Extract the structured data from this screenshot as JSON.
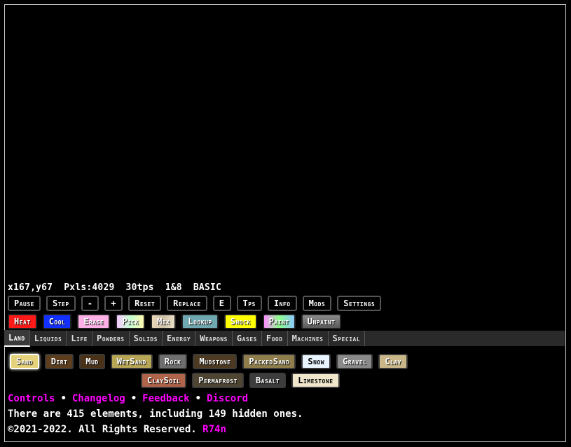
{
  "stats": "x167,y67  Pxls:4029  30tps  1&8  BASIC",
  "controls": [
    "Pause",
    "Step",
    "-",
    "+",
    "Reset",
    "Replace",
    "E",
    "Tps",
    "Info",
    "Mods",
    "Settings"
  ],
  "tools": [
    {
      "label": "Heat",
      "bg": "#ff1a1a",
      "color": "#ffffff"
    },
    {
      "label": "Cool",
      "bg": "#1230ff",
      "color": "#ffffff"
    },
    {
      "label": "Erase",
      "bg": "#ffb0e6",
      "color": "#ffffff"
    },
    {
      "label": "Pick",
      "bg": "linear-gradient(90deg,#f6c9ff,#c4ffd0,#fffab0)",
      "color": "#ffffff"
    },
    {
      "label": "Mix",
      "bg": "linear-gradient(90deg,#e9d7b8,#cdbfa8,#e9dfc6)",
      "color": "#ffffff"
    },
    {
      "label": "Lookup",
      "bg": "#6fa8b0",
      "color": "#ffffff"
    },
    {
      "label": "Shock",
      "bg": "#ffff00",
      "color": "#ffffff"
    },
    {
      "label": "Paint",
      "bg": "linear-gradient(90deg,#ff8cff,#8cff8c,#8cc8ff)",
      "color": "#ffffff"
    },
    {
      "label": "Unpaint",
      "bg": "linear-gradient(180deg,#8c8c8c,#5a5a5a)",
      "color": "#ffffff"
    }
  ],
  "categories": [
    "Land",
    "Liquids",
    "Life",
    "Powders",
    "Solids",
    "Energy",
    "Weapons",
    "Gases",
    "Food",
    "Machines",
    "Special"
  ],
  "active_category": "Land",
  "elements_row1": [
    {
      "label": "Sand",
      "bg": "#e6d27a",
      "color": "#ffffff",
      "selected": true
    },
    {
      "label": "Dirt",
      "bg": "#5c3d1e",
      "color": "#ffffff"
    },
    {
      "label": "Mud",
      "bg": "#4a3219",
      "color": "#ffffff"
    },
    {
      "label": "WetSand",
      "bg": "#b8a657",
      "color": "#ffffff"
    },
    {
      "label": "Rock",
      "bg": "#6f6f6f",
      "color": "#ffffff"
    },
    {
      "label": "Mudstone",
      "bg": "#4d3a22",
      "color": "#ffffff"
    },
    {
      "label": "PackedSand",
      "bg": "#8f7e4c",
      "color": "#ffffff"
    },
    {
      "label": "Snow",
      "bg": "#e8f4ff",
      "color": "#000000"
    },
    {
      "label": "Gravel",
      "bg": "#8a8a8a",
      "color": "#ffffff"
    },
    {
      "label": "Clay",
      "bg": "#c9b789",
      "color": "#ffffff"
    }
  ],
  "elements_row2": [
    {
      "label": "ClaySoil",
      "bg": "#b0644a",
      "color": "#ffffff"
    },
    {
      "label": "Permafrost",
      "bg": "#4e4533",
      "color": "#ffffff"
    },
    {
      "label": "Basalt",
      "bg": "#3d3d3d",
      "color": "#ffffff"
    },
    {
      "label": "Limestone",
      "bg": "#efe6cc",
      "color": "#000000"
    }
  ],
  "links": [
    "Controls",
    "Changelog",
    "Feedback",
    "Discord"
  ],
  "count_text": "There are 415 elements, including 149 hidden ones.",
  "copyright": "©2021-2022. All Rights Reserved.",
  "author": "R74n"
}
